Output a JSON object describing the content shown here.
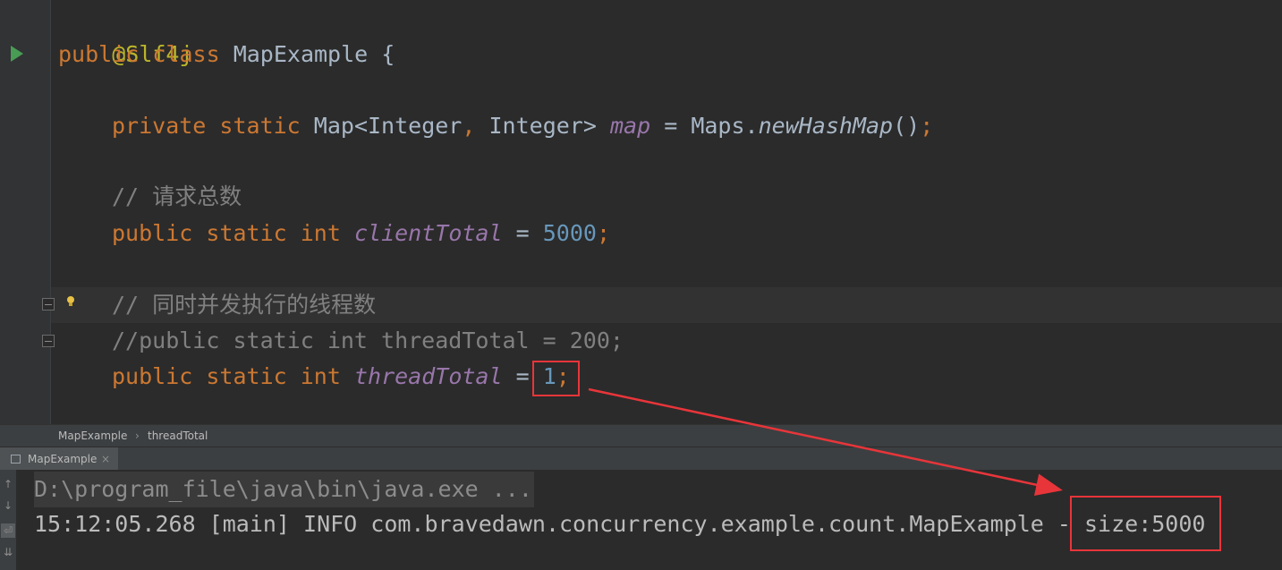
{
  "editor": {
    "lines": {
      "annotation": "@Slf4j",
      "class_decl": {
        "kw_public": "public",
        "kw_class": "class",
        "name": "MapExample",
        "brace": "{"
      },
      "map_field": {
        "kw_private": "private",
        "kw_static": "static",
        "type": "Map<Integer",
        "comma": ",",
        "type2": "Integer>",
        "name": "map",
        "eq": "=",
        "qualifier": "Maps.",
        "method": "newHashMap",
        "parens": "()",
        "semi": ";"
      },
      "comment_total": "// 请求总数",
      "client_total": {
        "kw_public": "public",
        "kw_static": "static",
        "kw_int": "int",
        "name": "clientTotal",
        "eq": "=",
        "value": "5000",
        "semi": ";"
      },
      "comment_threads": "// 同时并发执行的线程数",
      "commented_thread_total": "//public static int threadTotal = 200;",
      "thread_total": {
        "kw_public": "public",
        "kw_static": "static",
        "kw_int": "int",
        "name": "threadTotal",
        "eq": "=",
        "value": "1",
        "semi": ";"
      }
    }
  },
  "breadcrumbs": {
    "class": "MapExample",
    "separator": "›",
    "member": "threadTotal"
  },
  "run_panel": {
    "tab_label": "MapExample",
    "tab_close": "×",
    "toolbar_icons": [
      "arrow-up-icon",
      "arrow-down-icon",
      "soft-wrap-icon",
      "scroll-to-end-icon"
    ],
    "console": {
      "command": "D:\\program_file\\java\\bin\\java.exe ...",
      "output_prefix": "15:12:05.268 [main] INFO com.bravedawn.concurrency.example.count.MapExample - ",
      "output_result": "size:5000"
    }
  },
  "colors": {
    "keyword": "#cc7832",
    "annotation": "#bbb529",
    "field": "#9876aa",
    "number": "#6897bb",
    "comment": "#808080",
    "text": "#a9b7c6",
    "highlight": "#e8353a"
  }
}
